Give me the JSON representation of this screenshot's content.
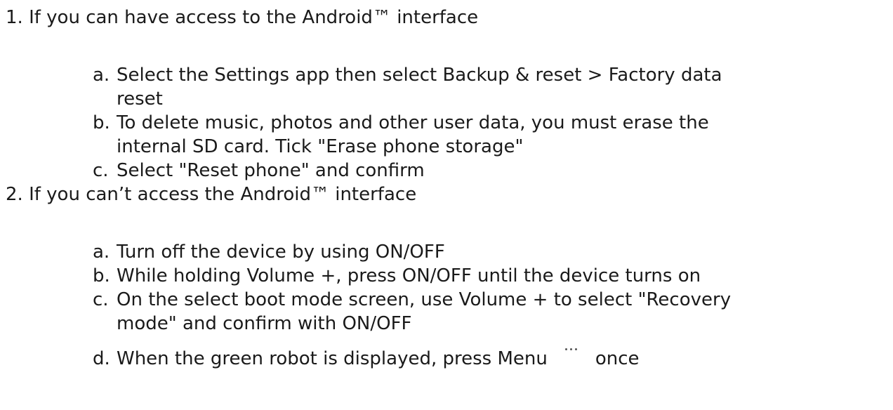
{
  "steps": [
    {
      "number": "1.",
      "title": "If you can have access to the Android™ interface",
      "items": [
        {
          "letter": "a.",
          "line1": "Select the Settings app then select Backup & reset > Factory data",
          "line2": "reset"
        },
        {
          "letter": "b.",
          "line1": "To delete music, photos and other user data, you must erase the",
          "line2": "internal SD card. Tick \"Erase phone storage\""
        },
        {
          "letter": "c.",
          "line1": "Select \"Reset phone\" and confirm"
        }
      ]
    },
    {
      "number": "2.",
      "title": "If you can’t access the Android™ interface",
      "items": [
        {
          "letter": "a.",
          "line1": "Turn off the device by using ON/OFF"
        },
        {
          "letter": "b.",
          "line1": "While holding Volume +, press ON/OFF until the device turns on"
        },
        {
          "letter": "c.",
          "line1": "On the select boot mode screen, use Volume + to select \"Recovery",
          "line2": "mode\" and confirm with ON/OFF"
        },
        {
          "letter": "d.",
          "line1_before": "When the green robot is displayed, press Menu",
          "line1_after": "once",
          "icon": "menu-dots-icon"
        }
      ]
    }
  ]
}
